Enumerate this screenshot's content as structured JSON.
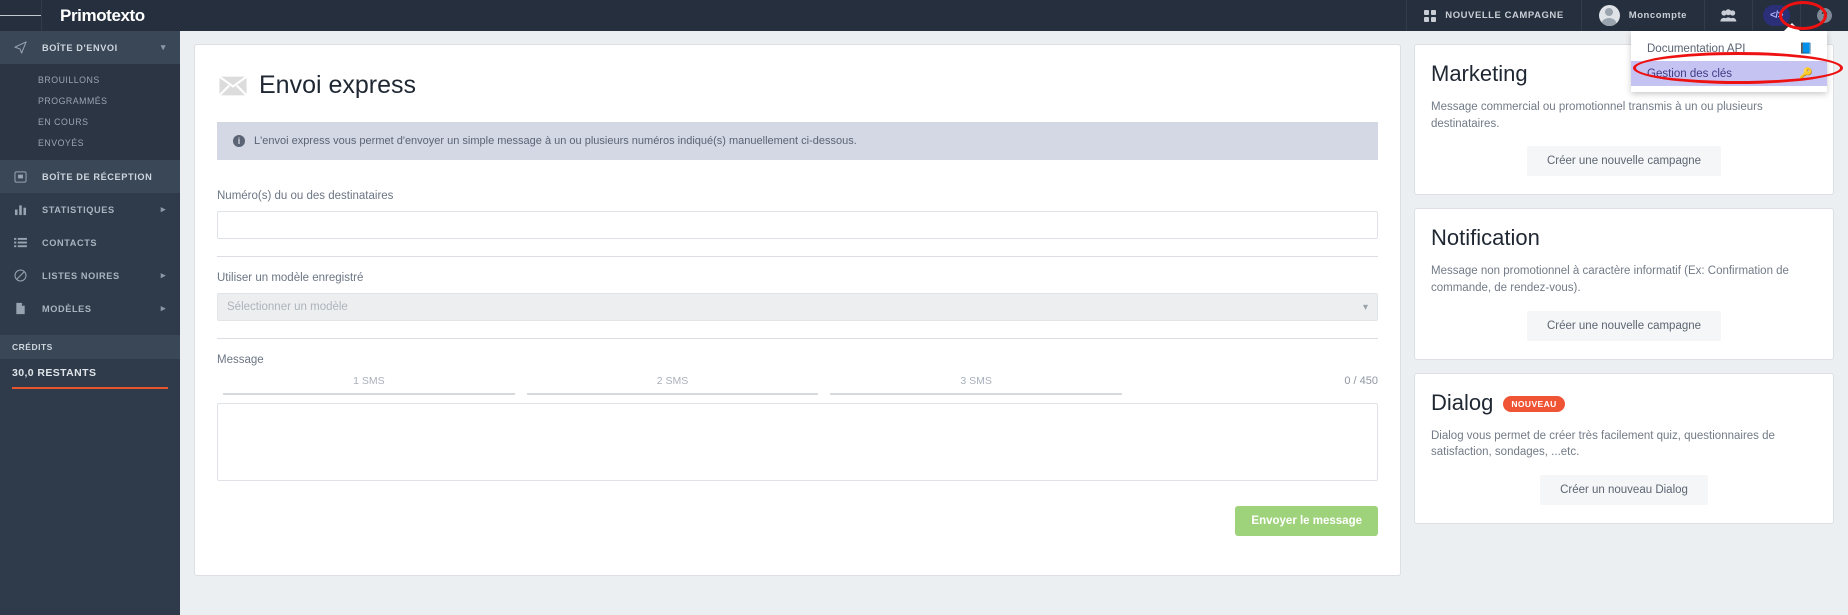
{
  "topbar": {
    "brand": "Primotexto",
    "menu_icon": "hamburger-icon",
    "new_campaign_label": "NOUVELLE CAMPAGNE",
    "account_label": "Moncompte",
    "contacts_icon": "group-icon",
    "code_icon": "</>",
    "help_icon": "?"
  },
  "dropdown": {
    "items": [
      {
        "label": "Documentation API",
        "icon": "book-icon",
        "active": false
      },
      {
        "label": "Gestion des clés",
        "icon": "key-icon",
        "active": true
      }
    ]
  },
  "sidebar": {
    "groups": [
      {
        "label": "BOÎTE D'ENVOI",
        "icon": "send-icon",
        "expanded": true,
        "children": [
          {
            "label": "BROUILLONS"
          },
          {
            "label": "PROGRAMMÉS"
          },
          {
            "label": "EN COURS"
          },
          {
            "label": "ENVOYÉS"
          }
        ]
      }
    ],
    "items": [
      {
        "label": "BOÎTE DE RÉCEPTION",
        "icon": "inbox-icon",
        "chevron": false
      },
      {
        "label": "STATISTIQUES",
        "icon": "chart-icon",
        "chevron": true
      },
      {
        "label": "CONTACTS",
        "icon": "list-icon",
        "chevron": false
      },
      {
        "label": "LISTES NOIRES",
        "icon": "ban-icon",
        "chevron": true
      },
      {
        "label": "MODÈLES",
        "icon": "file-icon",
        "chevron": true
      }
    ],
    "credits_header": "CRÉDITS",
    "credits_value": "30,0 RESTANTS"
  },
  "main": {
    "title": "Envoi express",
    "title_icon": "envelope-icon",
    "alert": "L'envoi express vous permet d'envoyer un simple message à un ou plusieurs numéros indiqué(s) manuellement ci-dessous.",
    "recipients_label": "Numéro(s) du ou des destinataires",
    "recipients_value": "",
    "recipients_placeholder": "",
    "template_label": "Utiliser un modèle enregistré",
    "template_selected": "Sélectionner un modèle",
    "message_label": "Message",
    "sms_segments": [
      "1 SMS",
      "2 SMS",
      "3 SMS"
    ],
    "char_counter": "0 / 450",
    "message_value": "",
    "message_placeholder": "",
    "send_button": "Envoyer le message"
  },
  "rightcol": {
    "cards": [
      {
        "title": "Marketing",
        "badge": "",
        "description": "Message commercial ou promotionnel transmis à un ou plusieurs destinataires.",
        "button": "Créer une nouvelle campagne"
      },
      {
        "title": "Notification",
        "badge": "",
        "description": "Message non promotionnel à caractère informatif (Ex: Confirmation de commande, de rendez-vous).",
        "button": "Créer une nouvelle campagne"
      },
      {
        "title": "Dialog",
        "badge": "NOUVEAU",
        "description": "Dialog vous permet de créer très facilement quiz, questionnaires de satisfaction, sondages, ...etc.",
        "button": "Créer un nouveau Dialog"
      }
    ]
  },
  "colors": {
    "topbar_bg": "#262f3d",
    "sidebar_bg": "#2f3b4a",
    "accent_orange": "#e8552d",
    "send_green": "#9ed37c",
    "badge_red": "#ef5434",
    "highlight_purple": "#c5c3f2",
    "annotation_red": "#ee1111",
    "code_badge_bg": "#2b2f77"
  }
}
